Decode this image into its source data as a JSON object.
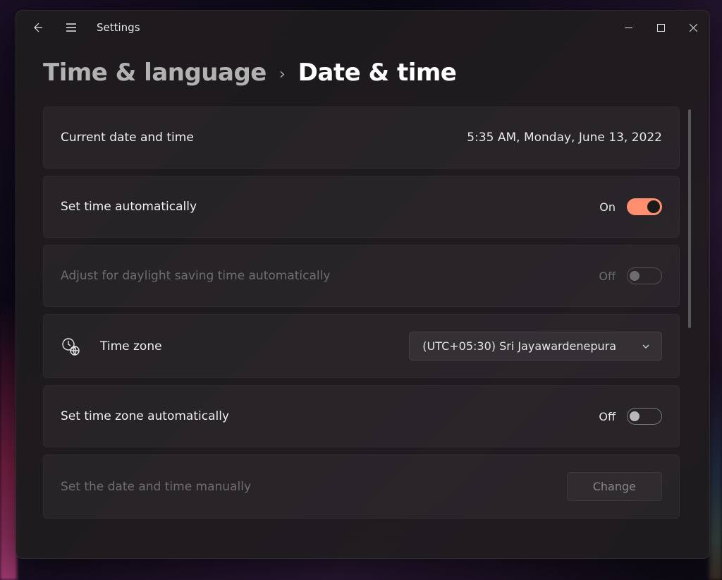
{
  "window": {
    "title": "Settings"
  },
  "breadcrumb": {
    "parent": "Time & language",
    "separator": "›",
    "current": "Date & time"
  },
  "currentDateTime": {
    "label": "Current date and time",
    "value": "5:35 AM, Monday, June 13, 2022"
  },
  "setTimeAuto": {
    "label": "Set time automatically",
    "state": "On"
  },
  "dstAuto": {
    "label": "Adjust for daylight saving time automatically",
    "state": "Off"
  },
  "timezone": {
    "label": "Time zone",
    "value": "(UTC+05:30) Sri Jayawardenepura"
  },
  "setTzAuto": {
    "label": "Set time zone automatically",
    "state": "Off"
  },
  "manual": {
    "label": "Set the date and time manually",
    "button": "Change"
  },
  "colors": {
    "accent": "#ff8f6e"
  }
}
